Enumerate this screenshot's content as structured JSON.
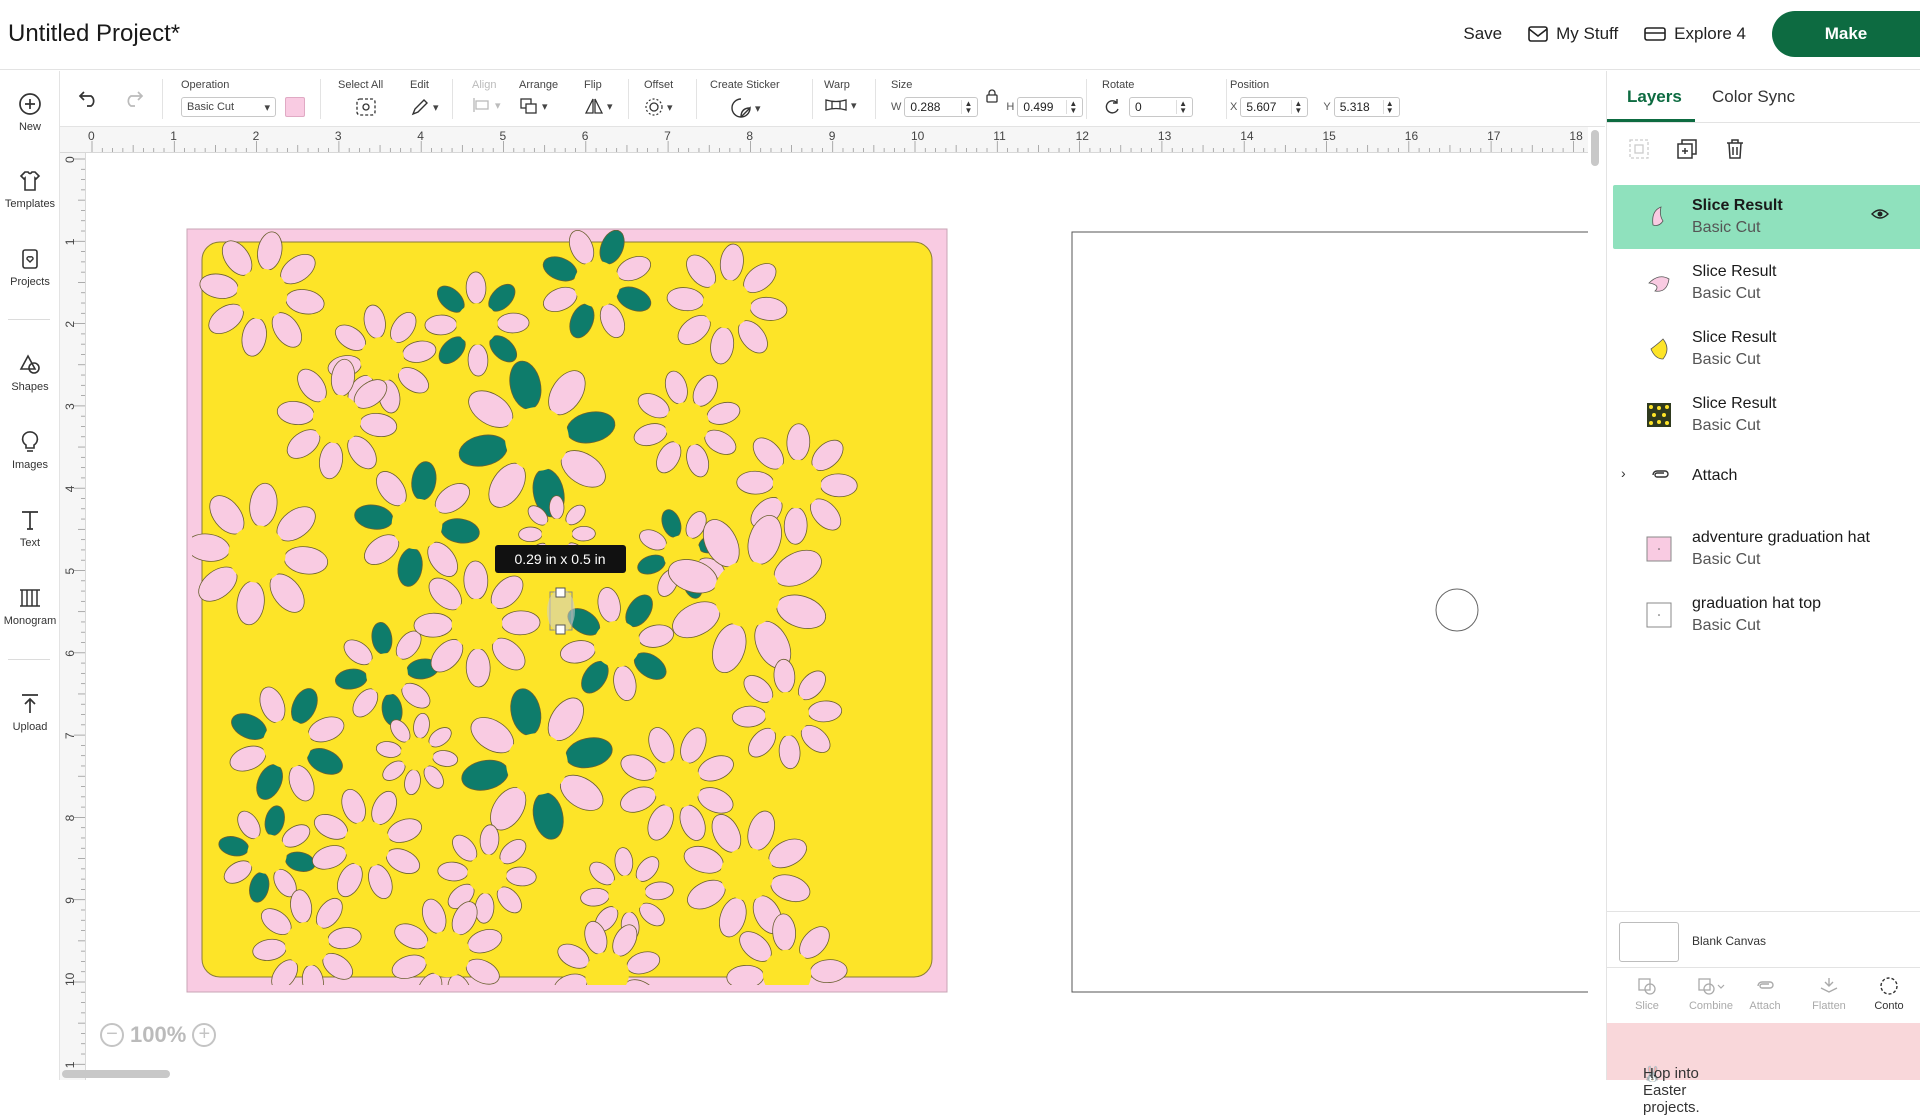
{
  "header": {
    "title": "Untitled Project*",
    "save_label": "Save",
    "my_stuff_label": "My Stuff",
    "machine_label": "Explore 4",
    "make_label": "Make"
  },
  "left_rail": {
    "items": [
      {
        "label": "New",
        "icon": "plus-circle-icon"
      },
      {
        "label": "Templates",
        "icon": "tshirt-icon"
      },
      {
        "label": "Projects",
        "icon": "projects-icon"
      },
      {
        "label": "Shapes",
        "icon": "shapes-icon"
      },
      {
        "label": "Images",
        "icon": "lightbulb-icon"
      },
      {
        "label": "Text",
        "icon": "text-icon"
      },
      {
        "label": "Monogram",
        "icon": "monogram-icon"
      },
      {
        "label": "Upload",
        "icon": "upload-icon"
      }
    ]
  },
  "toolbar": {
    "operation_label": "Operation",
    "operation_value": "Basic Cut",
    "operation_color": "#f9cbe2",
    "select_all_label": "Select All",
    "edit_label": "Edit",
    "align_label": "Align",
    "arrange_label": "Arrange",
    "flip_label": "Flip",
    "offset_label": "Offset",
    "create_sticker_label": "Create Sticker",
    "warp_label": "Warp",
    "size_label": "Size",
    "size_w_prefix": "W",
    "size_w": "0.288",
    "size_h_prefix": "H",
    "size_h": "0.499",
    "rotate_label": "Rotate",
    "rotate_value": "0",
    "position_label": "Position",
    "position_x_prefix": "X",
    "position_x": "5.607",
    "position_y_prefix": "Y",
    "position_y": "5.318"
  },
  "rulers": {
    "top": [
      "0",
      "1",
      "2",
      "3",
      "4",
      "5",
      "6",
      "7",
      "8",
      "9",
      "10",
      "11",
      "12",
      "13",
      "14",
      "15",
      "16",
      "17",
      "18"
    ],
    "left": [
      "0",
      "1",
      "2",
      "3",
      "4",
      "5",
      "6",
      "7",
      "8",
      "9",
      "10",
      "1"
    ]
  },
  "canvas": {
    "tooltip": "0.29  in x 0.5  in",
    "zoom": "100%",
    "colors": {
      "yellow": "#fde428",
      "pink": "#f9cbe2",
      "teal": "#0e7c6b"
    }
  },
  "panel": {
    "tabs": [
      "Layers",
      "Color Sync"
    ],
    "active_tab": "Layers",
    "layers": [
      {
        "name": "Slice Result",
        "op": "Basic Cut",
        "thumb": "pink-petal",
        "selected": true
      },
      {
        "name": "Slice Result",
        "op": "Basic Cut",
        "thumb": "pink-crescent",
        "selected": false
      },
      {
        "name": "Slice Result",
        "op": "Basic Cut",
        "thumb": "yellow-crescent",
        "selected": false
      },
      {
        "name": "Slice Result",
        "op": "Basic Cut",
        "thumb": "pattern-square",
        "selected": false
      }
    ],
    "attach_group": "Attach",
    "sub_layers": [
      {
        "name": "adventure graduation hat",
        "op": "Basic Cut"
      },
      {
        "name": "graduation hat top",
        "op": "Basic Cut"
      }
    ],
    "blank_canvas_label": "Blank Canvas",
    "actions": [
      "Slice",
      "Combine",
      "Attach",
      "Flatten",
      "Conto"
    ],
    "promo": "Hop into Easter projects.",
    "accent": "#0d6b41",
    "selected_bg": "#8fe1bd"
  }
}
